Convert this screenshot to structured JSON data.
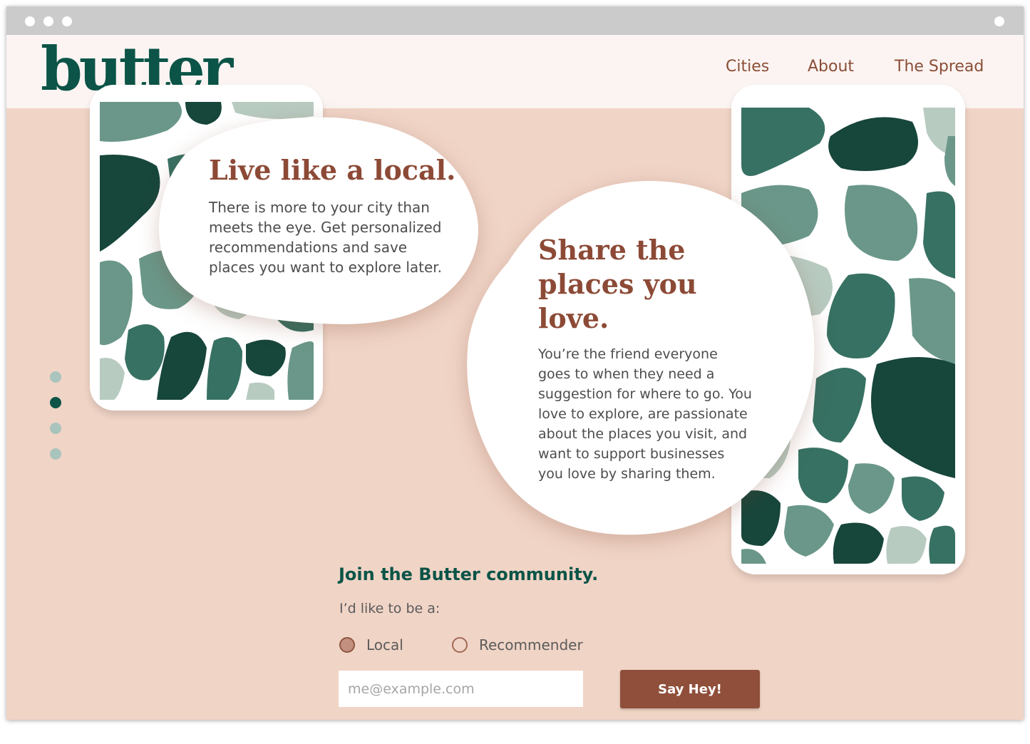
{
  "browser": {
    "window_dots": 3
  },
  "brand": {
    "logo_text": "butter"
  },
  "nav": {
    "links": [
      {
        "label": "Cities"
      },
      {
        "label": "About"
      },
      {
        "label": "The Spread"
      }
    ]
  },
  "hero": {
    "local_card": {
      "title": "Live like a local.",
      "body": "There is more to your city than meets the eye. Get personalized recommendations and save places you want to explore later."
    },
    "share_card": {
      "title": "Share the places you love.",
      "body": "You’re the friend everyone goes to when they need a suggestion for where to go. You love to explore, are passionate about the places you visit, and want to support businesses you love by sharing them."
    },
    "pager": {
      "count": 4,
      "active_index": 1
    }
  },
  "signup": {
    "heading": "Join the Butter community.",
    "prompt": "I’d like to be a:",
    "options": [
      {
        "label": "Local",
        "selected": true
      },
      {
        "label": "Recommender",
        "selected": false
      }
    ],
    "email_placeholder": "me@example.com",
    "email_value": "",
    "submit_label": "Say Hey!"
  },
  "colors": {
    "background": "#f0d4c6",
    "navbar": "#fbf4f2",
    "brand_green": "#0b5447",
    "accent_brown": "#8f4f3b",
    "pattern_dark": "#17463b",
    "pattern_mid": "#377163",
    "pattern_light": "#6a9789",
    "pattern_pale": "#b8cbc1"
  }
}
